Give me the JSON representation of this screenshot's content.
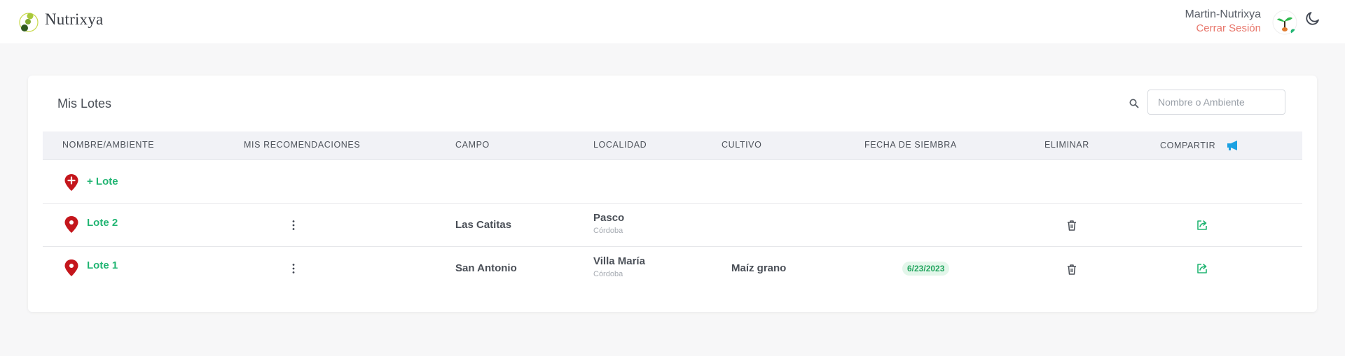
{
  "app": {
    "brand": "Nutrixya",
    "user_name": "Martin-Nutrixya",
    "logout_label": "Cerrar Sesión",
    "accent_green": "#22b573",
    "logout_color": "#e8766b",
    "pin_color": "#c4161c"
  },
  "page": {
    "title": "Mis Lotes",
    "search_placeholder": "Nombre o Ambiente",
    "search_value": ""
  },
  "table": {
    "columns": [
      "NOMBRE/AMBIENTE",
      "MIS RECOMENDACIONES",
      "CAMPO",
      "LOCALIDAD",
      "CULTIVO",
      "FECHA DE SIEMBRA",
      "ELIMINAR",
      "COMPARTIR"
    ],
    "add_label": "+ Lote",
    "rows": [
      {
        "name": "Lote 2",
        "campo": "Las Catitas",
        "localidad": "Pasco",
        "provincia": "Córdoba",
        "cultivo": "",
        "fecha": ""
      },
      {
        "name": "Lote 1",
        "campo": "San Antonio",
        "localidad": "Villa María",
        "provincia": "Córdoba",
        "cultivo": "Maíz grano",
        "fecha": "6/23/2023"
      }
    ]
  }
}
